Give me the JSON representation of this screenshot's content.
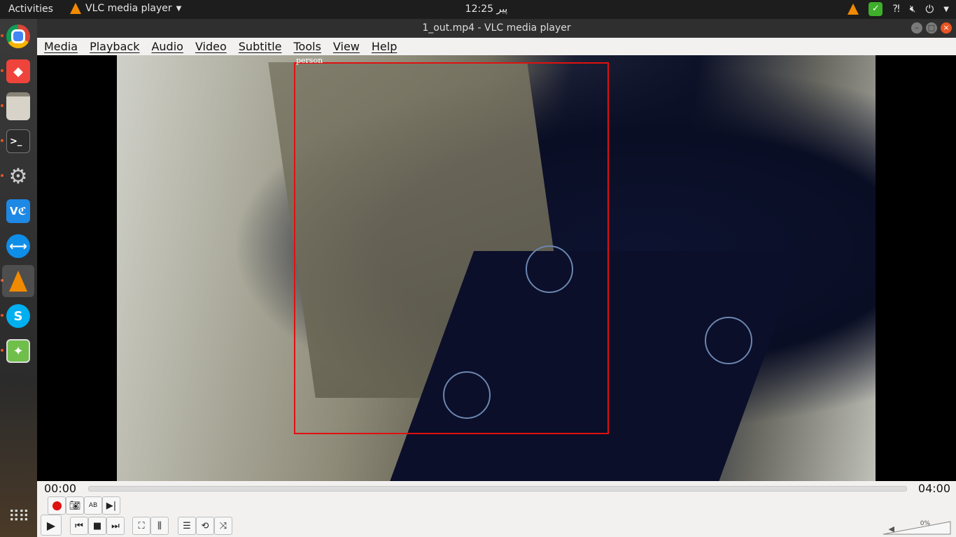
{
  "topbar": {
    "activities": "Activities",
    "app_name": "VLC media player",
    "clock": "12:25 پیر"
  },
  "window": {
    "title": "1_out.mp4 - VLC media player"
  },
  "menu": [
    "Media",
    "Playback",
    "Audio",
    "Video",
    "Subtitle",
    "Tools",
    "View",
    "Help"
  ],
  "video": {
    "detection_label": "person",
    "bbox_color": "#e01010"
  },
  "playback": {
    "current_time": "00:00",
    "total_time": "04:00",
    "progress": 0
  },
  "volume": {
    "label": "0%",
    "level": 0
  },
  "dock": [
    {
      "name": "chrome-icon",
      "running": true
    },
    {
      "name": "anydesk-icon",
      "running": true
    },
    {
      "name": "files-icon",
      "running": true
    },
    {
      "name": "terminal-icon",
      "running": true
    },
    {
      "name": "settings-icon",
      "running": true
    },
    {
      "name": "vscode-icon",
      "running": false
    },
    {
      "name": "teamviewer-icon",
      "running": false
    },
    {
      "name": "vlc-icon",
      "running": true,
      "active": true
    },
    {
      "name": "skype-icon",
      "running": true
    },
    {
      "name": "image-viewer-icon",
      "running": true
    }
  ],
  "colors": {
    "accent": "#e95420",
    "vlc_orange": "#f08a00"
  }
}
